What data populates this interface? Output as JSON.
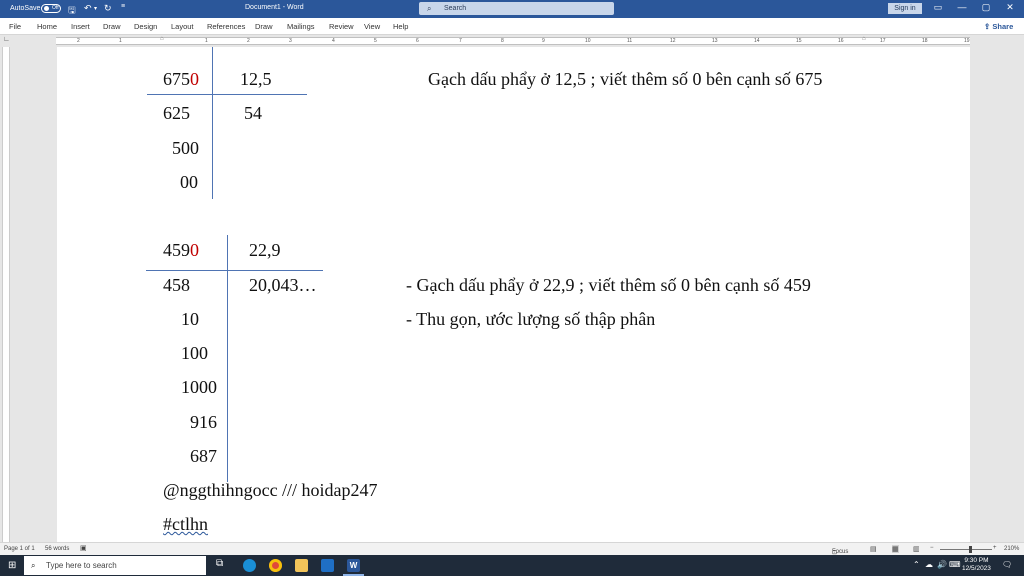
{
  "titlebar": {
    "autosave_label": "AutoSave",
    "autosave_state": "Off",
    "document_title": "Document1 - Word",
    "search_placeholder": "Search",
    "signin_label": "Sign in"
  },
  "ribbon": {
    "tabs": [
      "File",
      "Home",
      "Insert",
      "Draw",
      "Design",
      "Layout",
      "References",
      "Draw",
      "Mailings",
      "Review",
      "View",
      "Help"
    ],
    "share_label": "Share"
  },
  "ruler": {
    "numbers": [
      "2",
      "1",
      "1",
      "2",
      "3",
      "4",
      "5",
      "6",
      "7",
      "8",
      "9",
      "10",
      "11",
      "12",
      "13",
      "14",
      "15",
      "16",
      "17",
      "18",
      "19"
    ]
  },
  "document": {
    "div1": {
      "dividend_main": "675",
      "dividend_added": "0",
      "divisor": "12,5",
      "quotient": "54",
      "remainders": [
        "625",
        "500",
        "00"
      ],
      "note": "Gạch dấu phẩy ở 12,5 ; viết thêm số 0 bên cạnh số 675"
    },
    "div2": {
      "dividend_main": "459",
      "dividend_added": "0",
      "divisor": "22,9",
      "quotient": "20,043…",
      "remainders": [
        "458",
        "10",
        "100",
        "1000",
        "916",
        "687"
      ],
      "note1": "- Gạch dấu phẩy ở 22,9 ; viết thêm số 0 bên cạnh số 459",
      "note2": "- Thu gọn, ước lượng số thập phân"
    },
    "signature": "@nggthihngocc /// hoidap247",
    "hashtag": "#ctlhn"
  },
  "statusbar": {
    "page": "Page 1 of 1",
    "words": "56 words",
    "focus": "Focus",
    "zoom": "210%"
  },
  "taskbar": {
    "search_placeholder": "Type here to search",
    "time": "9:30 PM",
    "date": "12/5/2023"
  }
}
